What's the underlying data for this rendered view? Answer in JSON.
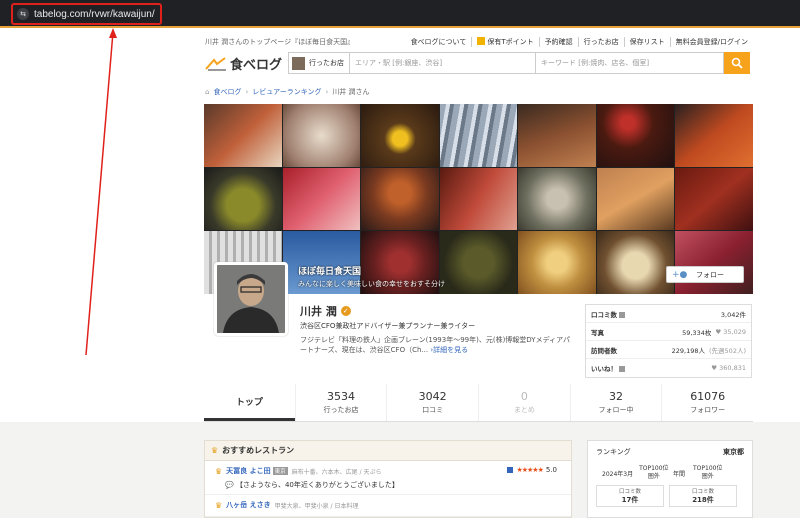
{
  "browser": {
    "url": "tabelog.com/rvwr/kawaijun/",
    "site_icon": "tune-icon"
  },
  "header": {
    "user_page": "川井 潤さんのトップページ『ほぼ毎日食天国』",
    "links": [
      "食べログについて",
      "保有Tポイント",
      "予約確認",
      "行ったお店",
      "保存リスト",
      "無料会員登録/ログイン"
    ],
    "logo_text": "食べログ",
    "been_label": "行ったお店",
    "area_placeholder": "エリア・駅 [例:銀座、渋谷]",
    "keyword_placeholder": "キーワード [例:焼肉、店名、個室]",
    "accent": "#f7a21b"
  },
  "breadcrumb": [
    "食べログ",
    "レビュアーランキング",
    "川井 潤さん"
  ],
  "cover": {
    "title": "ほぼ毎日食天国",
    "subtitle": "みんなに楽しく美味しい食の幸せをおすそ分け",
    "follow_label": "フォロー"
  },
  "profile": {
    "name": "川井 潤",
    "title": "渋谷区CFO兼政社アドバイザー兼プランナー兼ライター",
    "bio": "フジテレビ「料理の鉄人」企画ブレーン(1993年〜99年)、元(株)博報堂DYメディアパートナーズ、現在は、渋谷区CFO（Ch...",
    "more": "詳細を見る"
  },
  "stats": [
    {
      "key": "口コミ数",
      "value": "3,042件",
      "sub": ""
    },
    {
      "key": "写真",
      "value": "59,334枚",
      "sub": "35,029"
    },
    {
      "key": "訪問者数",
      "value": "229,198人",
      "sub": "(先週502人)"
    },
    {
      "key": "いいね！",
      "value": "",
      "sub": "360,831"
    }
  ],
  "tabs": [
    {
      "label": "トップ",
      "num": ""
    },
    {
      "label": "行ったお店",
      "num": "3534"
    },
    {
      "label": "口コミ",
      "num": "3042"
    },
    {
      "label": "まとめ",
      "num": "0"
    },
    {
      "label": "フォロー中",
      "num": "32"
    },
    {
      "label": "フォロワー",
      "num": "61076"
    }
  ],
  "recommended": {
    "heading": "おすすめレストラン",
    "items": [
      {
        "name": "天冨良 よこ田",
        "badge": "東京",
        "meta": "麻布十番、六本木、広尾 / 天ぷら",
        "rating": "5.0",
        "stars": "★★★★★",
        "comment": "【さようなら、40年近くありがとうございました】"
      },
      {
        "name": "八ヶ岳 えさき",
        "badge": "",
        "meta": "甲斐大泉、甲斐小泉 / 日本料理",
        "rating": "",
        "stars": "",
        "comment": ""
      }
    ]
  },
  "ranking": {
    "label": "ランキング",
    "region": "東京都",
    "period1": "2024年3月",
    "p1_rank_label": "TOP100位",
    "p1_rank_value": "圏外",
    "period2": "年間",
    "p2_rank_label": "TOP100位",
    "p2_rank_value": "圏外",
    "box1_label": "口コミ数",
    "box1_value": "17件",
    "box2_label": "口コミ数",
    "box2_value": "218件"
  }
}
